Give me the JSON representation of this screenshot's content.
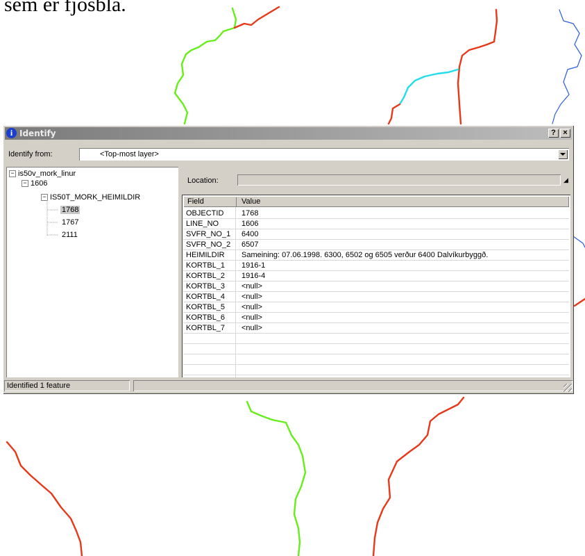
{
  "background": {
    "caption": "sem er fjósbla.",
    "line_colors": {
      "boundary_red": "#e83818",
      "green": "#66ee1a",
      "cyan": "#22ddee",
      "blue": "#2a5cdc"
    }
  },
  "dialog": {
    "title": "Identify",
    "title_icon": "info-icon",
    "help_button": "?",
    "close_button": "×",
    "identify_from_label": "Identify from:",
    "identify_from_value": "<Top-most layer>",
    "location_label": "Location:",
    "location_value": "",
    "tree": {
      "layer": "is50v_mork_linur",
      "group": "1606",
      "table": "IS50T_MORK_HEIMILDIR",
      "items": [
        "1768",
        "1767",
        "2111"
      ],
      "selected": "1768"
    },
    "grid": {
      "headers": {
        "field": "Field",
        "value": "Value"
      },
      "rows": [
        {
          "field": "OBJECTID",
          "value": "1768"
        },
        {
          "field": "LINE_NO",
          "value": "1606"
        },
        {
          "field": "SVFR_NO_1",
          "value": "6400"
        },
        {
          "field": "SVFR_NO_2",
          "value": "6507"
        },
        {
          "field": "HEIMILDIR",
          "value": "Sameining:  07.06.1998.   6300, 6502 og 6505 verður 6400 Dalvíkurbyggð."
        },
        {
          "field": "KORTBL_1",
          "value": "1916-1"
        },
        {
          "field": "KORTBL_2",
          "value": "1916-4"
        },
        {
          "field": "KORTBL_3",
          "value": "<null>"
        },
        {
          "field": "KORTBL_4",
          "value": "<null>"
        },
        {
          "field": "KORTBL_5",
          "value": "<null>"
        },
        {
          "field": "KORTBL_6",
          "value": "<null>"
        },
        {
          "field": "KORTBL_7",
          "value": "<null>"
        }
      ]
    },
    "status": "Identified 1 feature"
  }
}
